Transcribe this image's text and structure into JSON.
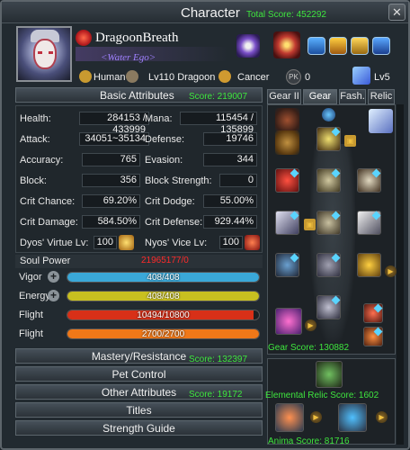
{
  "window": {
    "title": "Character",
    "total_score_label": "Total Score: 452292"
  },
  "header": {
    "name": "DragoonBreath",
    "guild": "<Water Ego>",
    "race": "Human",
    "level_class": "Lv110 Dragoon",
    "zodiac": "Cancer",
    "pk_icon": "PK",
    "pk_value": "0",
    "rank_level": "Lv5"
  },
  "basic": {
    "label": "Basic Attributes",
    "score": "Score: 219007"
  },
  "stats": {
    "health_l": "Health:",
    "health_v": "284153 / 433999",
    "mana_l": "Mana:",
    "mana_v": "115454 / 135899",
    "attack_l": "Attack:",
    "attack_v": "34051~35134",
    "defense_l": "Defense:",
    "defense_v": "19746",
    "accuracy_l": "Accuracy:",
    "accuracy_v": "765",
    "evasion_l": "Evasion:",
    "evasion_v": "344",
    "block_l": "Block:",
    "block_v": "356",
    "blockstr_l": "Block Strength:",
    "blockstr_v": "0",
    "critchance_l": "Crit Chance:",
    "critchance_v": "69.20%",
    "critdodge_l": "Crit Dodge:",
    "critdodge_v": "55.00%",
    "critdamage_l": "Crit Damage:",
    "critdamage_v": "584.50%",
    "critdefense_l": "Crit Defense:",
    "critdefense_v": "929.44%",
    "dyos_l": "Dyos' Virtue Lv:",
    "dyos_v": "100",
    "nyos_l": "Nyos' Vice Lv:",
    "nyos_v": "100"
  },
  "soul": {
    "label": "Soul Power",
    "value": "21965177/0"
  },
  "bars": {
    "vigor_l": "Vigor",
    "vigor_v": "408/408",
    "vigor_pct": 100,
    "energy_l": "Energy",
    "energy_v": "408/408",
    "energy_pct": 100,
    "flight1_l": "Flight",
    "flight1_v": "10494/10800",
    "flight1_pct": 97,
    "flight2_l": "Flight",
    "flight2_v": "2700/2700",
    "flight2_pct": 100
  },
  "sections": {
    "mastery": "Mastery/Resistance",
    "mastery_score": "Score: 132397",
    "pet": "Pet Control",
    "other": "Other Attributes",
    "other_score": "Score: 19172",
    "titles": "Titles",
    "guide": "Strength Guide"
  },
  "tabs": [
    "Gear II",
    "Gear",
    "Fash.",
    "Relic"
  ],
  "gear": {
    "gear_score": "Gear Score: 130882",
    "relic_score": "Elemental Relic Score: 1602",
    "anima_score": "Anima Score: 81716"
  },
  "colors": {
    "score_green": "#3ee53e",
    "soul_red": "#ff2a2a",
    "vigor": "#3aa8d8",
    "energy": "#c8c020",
    "flight1": "#d83018",
    "flight2": "#f07818"
  }
}
